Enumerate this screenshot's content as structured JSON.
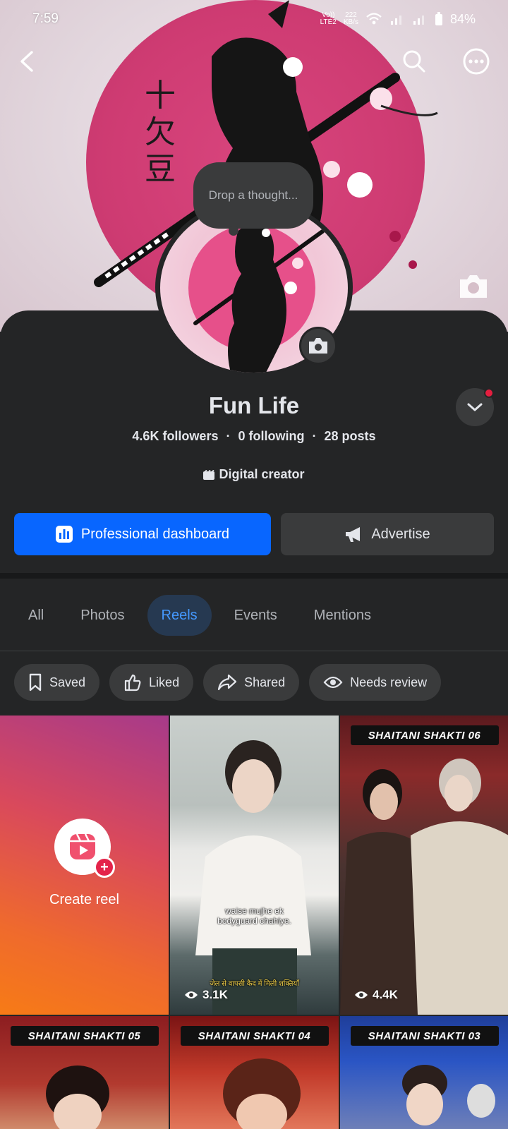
{
  "status_bar": {
    "time": "7:59",
    "network_top": "Vo))",
    "network_bottom": "LTE2",
    "speed_top": "222",
    "speed_bottom": "KB/s",
    "battery": "84%"
  },
  "cover": {
    "calligraphy": "十欠豆"
  },
  "profile": {
    "thought_placeholder": "Drop a thought...",
    "name": "Fun Life",
    "followers": "4.6K followers",
    "following": "0 following",
    "posts": "28 posts",
    "separator": "·",
    "category": "Digital creator"
  },
  "actions": {
    "dashboard_label": "Professional dashboard",
    "advertise_label": "Advertise"
  },
  "tabs": [
    {
      "label": "All",
      "active": false
    },
    {
      "label": "Photos",
      "active": false
    },
    {
      "label": "Reels",
      "active": true
    },
    {
      "label": "Events",
      "active": false
    },
    {
      "label": "Mentions",
      "active": false
    }
  ],
  "chips": [
    {
      "label": "Saved",
      "icon": "bookmark-icon"
    },
    {
      "label": "Liked",
      "icon": "thumbs-up-icon"
    },
    {
      "label": "Shared",
      "icon": "share-icon"
    },
    {
      "label": "Needs review",
      "icon": "eye-icon"
    }
  ],
  "reels": {
    "create_label": "Create reel",
    "items": [
      {
        "views": "3.1K",
        "subtitle_line1": "waise mujhe ek",
        "subtitle_line2": "bodyguard chahiye.",
        "caption": "जेल से वापसी कैद में मिली शक्तियाँ"
      },
      {
        "title": "SHAITANI SHAKTI 06",
        "views": "4.4K"
      },
      {
        "title": "SHAITANI SHAKTI 05"
      },
      {
        "title": "SHAITANI SHAKTI 04"
      },
      {
        "title": "SHAITANI SHAKTI 03"
      }
    ]
  },
  "colors": {
    "accent": "#0866ff",
    "active_tab_bg": "#263951",
    "active_tab_text": "#4599ff",
    "background": "#242526"
  }
}
